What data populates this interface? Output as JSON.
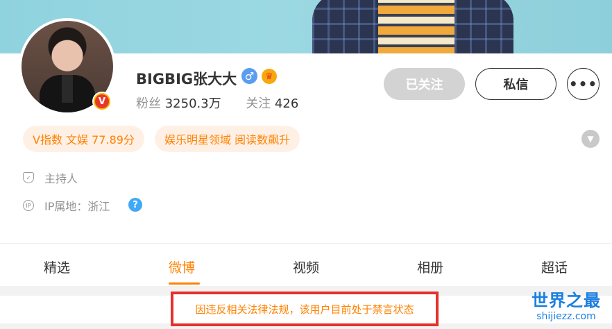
{
  "profile": {
    "name": "BIGBIG张大大",
    "gender_icon": "♂",
    "fans_label": "粉丝",
    "fans_count": "3250.3万",
    "following_label": "关注",
    "following_count": "426"
  },
  "actions": {
    "followed_label": "已关注",
    "message_label": "私信",
    "more_label": "•••"
  },
  "tags": [
    {
      "label": "V指数 文娱 77.89分"
    },
    {
      "label": "娱乐明星领域 阅读数飙升"
    }
  ],
  "info": {
    "occupation": "主持人",
    "ip_location": "IP属地：浙江"
  },
  "tabs": [
    {
      "label": "精选"
    },
    {
      "label": "微博"
    },
    {
      "label": "视频"
    },
    {
      "label": "相册"
    },
    {
      "label": "超话"
    }
  ],
  "active_tab": "微博",
  "notice": "因违反相关法律法规，该用户目前处于禁言状态",
  "watermark": {
    "title": "世界之最",
    "domain": "shijiezz.com"
  },
  "colors": {
    "accent": "#ff8200",
    "verified": "#f7b500",
    "notice_border": "#e5312b",
    "watermark": "#1a7fe0"
  },
  "icons": {
    "verified_badge": "verified-v-icon",
    "gender": "male-icon",
    "crown": "crown-icon",
    "expand": "chevron-down-icon",
    "occupation": "shield-icon",
    "ip": "ip-location-icon",
    "help": "question-icon"
  }
}
